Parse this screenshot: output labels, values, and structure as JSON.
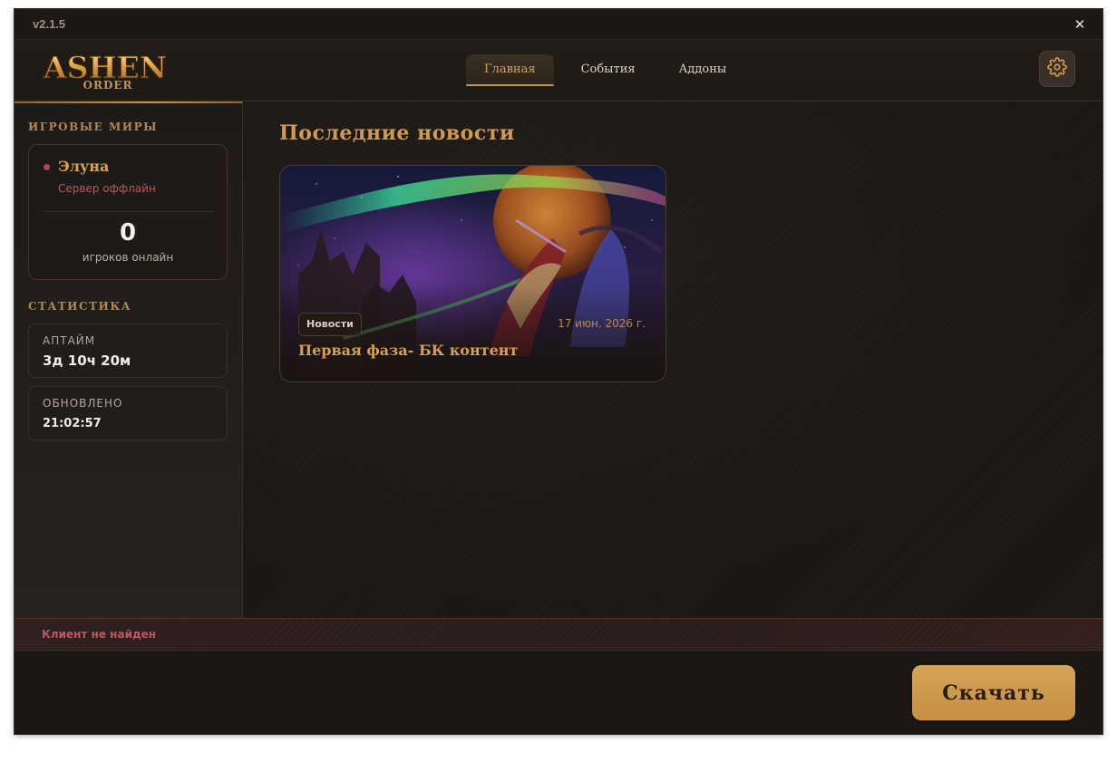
{
  "app": {
    "version": "v2.1.5",
    "logo_text": "ASHEN",
    "logo_subtext": "ORDER"
  },
  "window_controls": {
    "close_symbol": "✕"
  },
  "nav": {
    "tabs": [
      {
        "label": "Главная",
        "active": true
      },
      {
        "label": "События",
        "active": false
      },
      {
        "label": "Аддоны",
        "active": false
      }
    ]
  },
  "settings": {
    "icon": "gear-icon"
  },
  "sidebar": {
    "realms_title": "ИГРОВЫЕ МИРЫ",
    "realm": {
      "name": "Элуна",
      "status": "Сервер оффлайн",
      "players_online": "0",
      "players_online_label": "игроков онлайн",
      "status_color": "#b6454c"
    },
    "stats_title": "СТАТИСТИКА",
    "stats": [
      {
        "label": "АПТАЙМ",
        "value": "3д 10ч 20м"
      },
      {
        "label": "ОБНОВЛЕНО",
        "value": "21:02:57"
      }
    ]
  },
  "main": {
    "title": "Последние новости",
    "news": [
      {
        "tag": "Новости",
        "date": "17 июн. 2026 г.",
        "title": "Первая фаза- БК контент"
      }
    ]
  },
  "statusbar": {
    "text": "Клиент не найден",
    "color": "#c4545b"
  },
  "footer": {
    "download_label": "Скачать"
  },
  "colors": {
    "accent_gold": "#c9924a",
    "background": "#1c1814",
    "error_red": "#c4545b"
  }
}
